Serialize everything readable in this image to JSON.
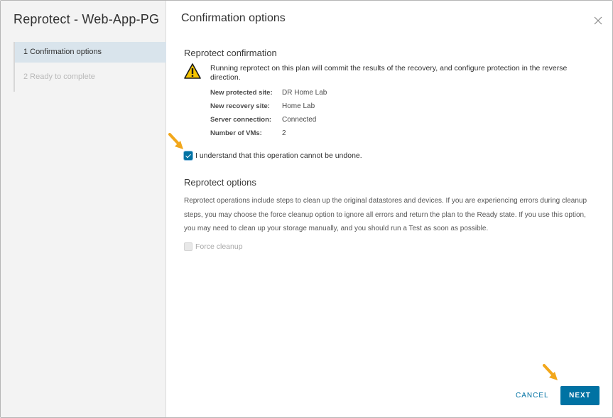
{
  "wizard": {
    "title": "Reprotect - Web-App-PG"
  },
  "steps": [
    {
      "label": "1  Confirmation options",
      "state": "active"
    },
    {
      "label": "2  Ready to complete",
      "state": "disabled"
    }
  ],
  "page": {
    "title": "Confirmation options"
  },
  "confirmation": {
    "title": "Reprotect confirmation",
    "warning_text": "Running reprotect on this plan will commit the results of the recovery, and configure protection in the reverse direction.",
    "details": [
      {
        "key": "New protected site:",
        "value": "DR Home Lab"
      },
      {
        "key": "New recovery site:",
        "value": "Home Lab"
      },
      {
        "key": "Server connection:",
        "value": "Connected"
      },
      {
        "key": "Number of VMs:",
        "value": "2"
      }
    ],
    "ack_label": "I understand that this operation cannot be undone.",
    "ack_checked": true
  },
  "options": {
    "title": "Reprotect options",
    "description": "Reprotect operations include steps to clean up the original datastores and devices. If you are experiencing errors during cleanup steps, you may choose the force cleanup option to ignore all errors and return the plan to the Ready state. If you use this option, you may need to clean up your storage manually, and you should run a Test as soon as possible.",
    "force_label": "Force cleanup",
    "force_checked": false
  },
  "footer": {
    "cancel_label": "CANCEL",
    "next_label": "NEXT"
  },
  "colors": {
    "accent": "#0072a3",
    "warning": "#f5c400",
    "annotation_arrow": "#f2a71b"
  },
  "icons": {
    "close": "close-icon",
    "warning": "warning-triangle-icon",
    "check": "checkmark-icon",
    "annotation": "arrow-pointer-icon"
  }
}
